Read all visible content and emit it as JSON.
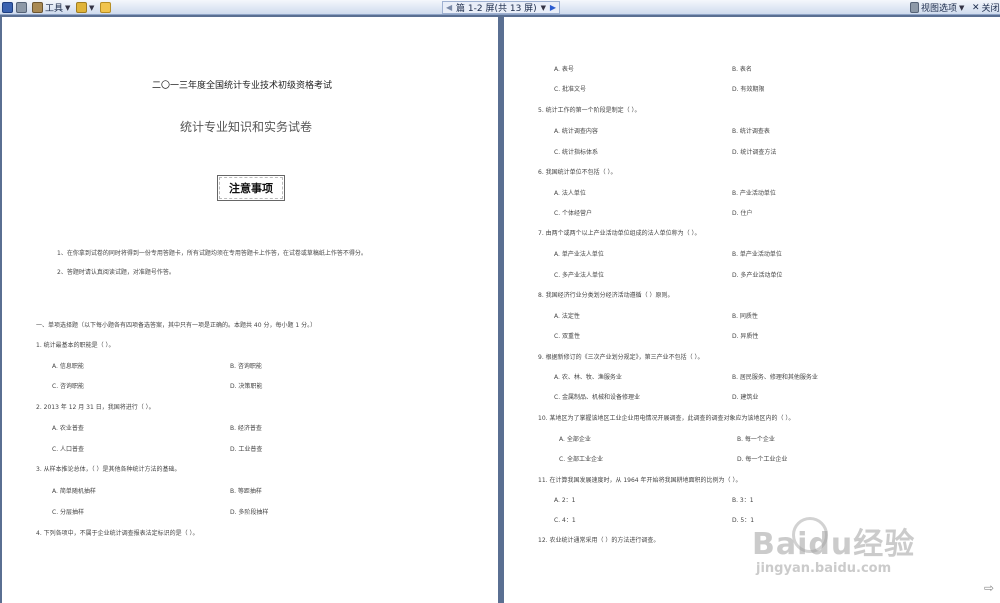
{
  "toolbar": {
    "tools_label": "工具",
    "page_nav": "篇 1-2 屏(共 13 屏)",
    "view_options": "视图选项",
    "close": "关闭"
  },
  "page1": {
    "exam_title": "二〇一三年度全国统计专业技术初级资格考试",
    "paper_title": "统计专业知识和实务试卷",
    "notice_box": "注意事项",
    "notice_1": "1、在你拿到试卷的同时将得到一份专用答题卡，所有试题均须在专用答题卡上作答，在试卷或草稿纸上作答不得分。",
    "notice_2": "2、答题时请认真阅读试题，对准题号作答。",
    "section_1": "一、单项选择题（以下每小题各有四项备选答案，其中只有一项是正确的。本题共 40 分，每小题 1 分。）",
    "q1": "1. 统计最基本的职能是（    ）。",
    "q1a": "A. 信息职能",
    "q1b": "B. 咨询职能",
    "q1c": "C. 咨询职能",
    "q1d": "D. 决策职能",
    "q2": "2. 2013 年 12 月 31 日，我国将进行（    ）。",
    "q2a": "A. 农业普查",
    "q2b": "B. 经济普查",
    "q2c": "C. 人口普查",
    "q2d": "D. 工业普查",
    "q3": "3. 从样本推论总体，（    ）是其他各种统计方法的基础。",
    "q3a": "A. 简单随机抽样",
    "q3b": "B. 等距抽样",
    "q3c": "C. 分层抽样",
    "q3d": "D. 多阶段抽样",
    "q4": "4. 下列各项中，不属于企业统计调查报表法定标识的是（    ）。"
  },
  "page2": {
    "q4a": "A. 表号",
    "q4b": "B. 表名",
    "q4c": "C. 批准文号",
    "q4d": "D. 有效期限",
    "q5": "5. 统计工作的第一个阶段是制定（    ）。",
    "q5a": "A. 统计调查内容",
    "q5b": "B. 统计调查表",
    "q5c": "C. 统计指标体系",
    "q5d": "D. 统计调查方法",
    "q6": "6. 我国统计单位不包括（    ）。",
    "q6a": "A. 法人单位",
    "q6b": "B. 产业活动单位",
    "q6c": "C. 个体经营户",
    "q6d": "D. 住户",
    "q7": "7. 由两个或两个以上产业活动单位组成的法人单位称为（    ）。",
    "q7a": "A. 单产业法人单位",
    "q7b": "B. 单产业活动单位",
    "q7c": "C. 多产业法人单位",
    "q7d": "D. 多产业活动单位",
    "q8": "8. 我国经济行业分类划分经济活动遵循（    ）原则。",
    "q8a": "A. 法定性",
    "q8b": "B. 同质性",
    "q8c": "C. 双重性",
    "q8d": "D. 异质性",
    "q9": "9. 根据新修订的《三次产业划分规定》，第三产业不包括（    ）。",
    "q9a": "A. 农、林、牧、渔服务业",
    "q9b": "B. 居民服务、修理和其他服务业",
    "q9c": "C. 金属制品、机械和设备修理业",
    "q9d": "D. 建筑业",
    "q10": "10. 某地区为了掌握该地区工业企业用电情况开展调查，此调查的调查对象应为该地区内的（    ）。",
    "q10a": "A. 全部企业",
    "q10b": "B. 每一个企业",
    "q10c": "C. 全部工业企业",
    "q10d": "D. 每一个工业企业",
    "q11": "11. 在计算我国发展速度时，从 1964 年开始将我国耕地面积的比例为（    ）。",
    "q11a": "A. 2：1",
    "q11b": "B. 3：1",
    "q11c": "C. 4：1",
    "q11d": "D. 5：1",
    "q12": "12. 农业统计通常采用（    ）的方法进行调查。"
  },
  "watermark": {
    "brand": "Baidu经验",
    "url": "jingyan.baidu.com"
  },
  "colors": {
    "background": "#5a6f92",
    "toolbar": "#cfdbee",
    "page": "#ffffff"
  },
  "icons": [
    "save-icon",
    "print-icon",
    "tools-icon",
    "highlighter-icon",
    "folder-icon",
    "prev-page-icon",
    "next-page-icon",
    "view-options-icon",
    "close-icon"
  ]
}
